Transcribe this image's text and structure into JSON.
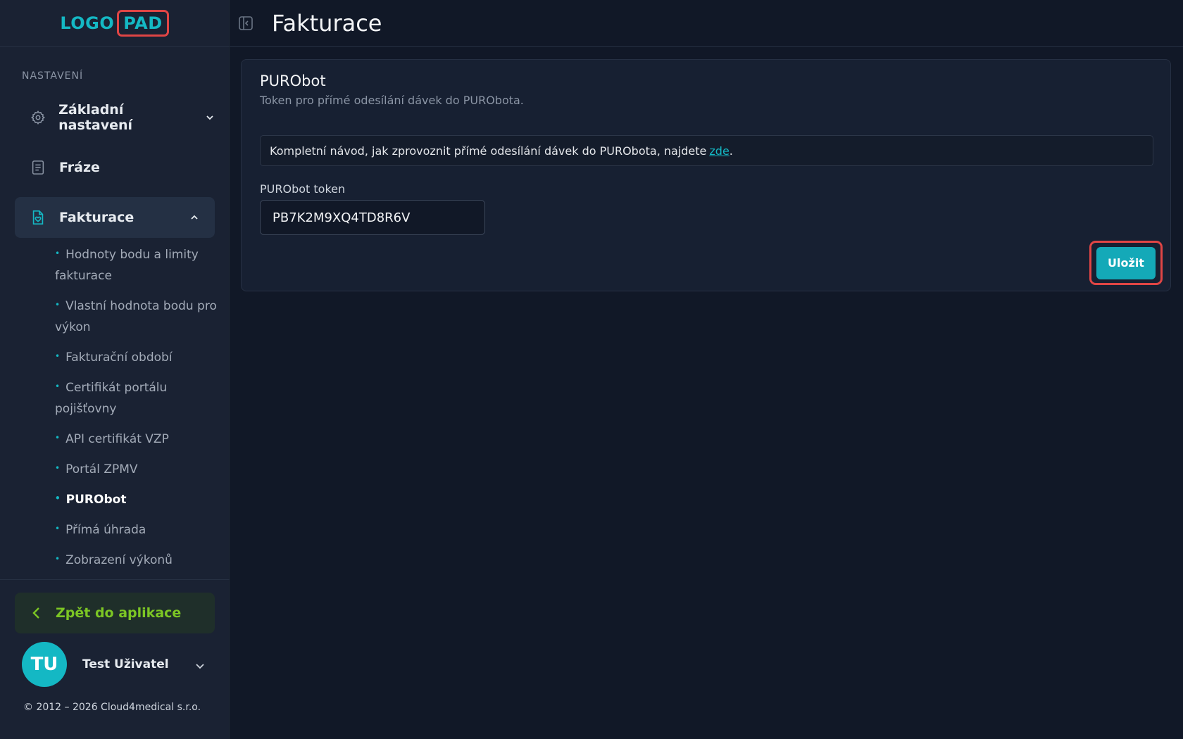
{
  "logo": {
    "part1": "LOGO",
    "part2": "PAD"
  },
  "sidebar": {
    "section_title": "NASTAVENÍ",
    "items": [
      {
        "label": "Základní nastavení"
      },
      {
        "label": "Fráze"
      },
      {
        "label": "Fakturace"
      }
    ],
    "sub_items": [
      {
        "label": "Hodnoty bodu a limity fakturace"
      },
      {
        "label": "Vlastní hodnota bodu pro výkon"
      },
      {
        "label": "Fakturační období"
      },
      {
        "label": "Certifikát portálu pojišťovny"
      },
      {
        "label": "API certifikát VZP"
      },
      {
        "label": "Portál ZPMV"
      },
      {
        "label": "PURObot"
      },
      {
        "label": "Přímá úhrada"
      },
      {
        "label": "Zobrazení výkonů"
      }
    ],
    "back_button": "Zpět do aplikace",
    "user": {
      "initials": "TU",
      "name": "Test Uživatel"
    },
    "copyright": "© 2012 – 2026 Cloud4medical s.r.o."
  },
  "header": {
    "title": "Fakturace"
  },
  "card": {
    "title": "PURObot",
    "description": "Token pro přímé odesílání dávek do PURObota.",
    "info_text": "Kompletní návod, jak zprovoznit přímé odesílání dávek do PURObota, najdete",
    "info_link": "zde",
    "info_suffix": ".",
    "field_label": "PURObot token",
    "field_value": "PB7K2M9XQ4TD8R6V",
    "save_label": "Uložit"
  },
  "colors": {
    "accent": "#14b8c4",
    "back_green": "#7cc624",
    "highlight": "#e04545"
  }
}
